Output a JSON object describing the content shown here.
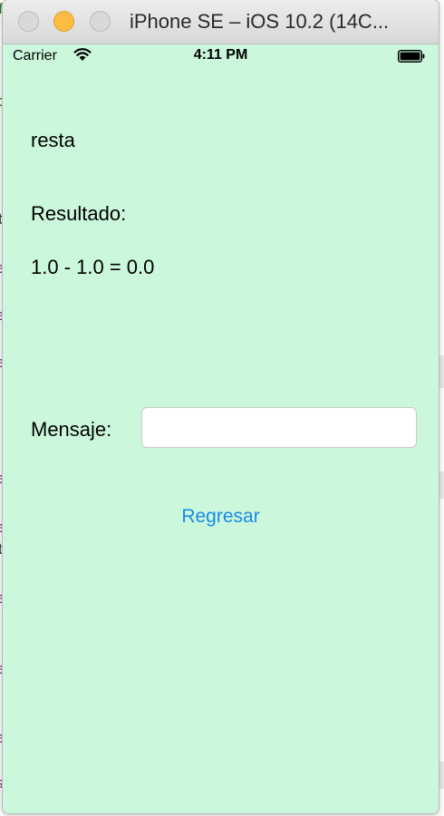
{
  "window": {
    "title": "iPhone SE – iOS 10.2 (14C..."
  },
  "status_bar": {
    "carrier": "Carrier",
    "time": "4:11 PM"
  },
  "screen": {
    "operation": "resta",
    "result_title": "Resultado:",
    "result_value": "1.0 - 1.0 = 0.0",
    "message_label": "Mensaje:",
    "message_value": "",
    "back_button_label": "Regresar"
  },
  "colors": {
    "screen_background": "#cbf8dc",
    "link_blue": "#1a8ae6",
    "minimize_yellow": "#fdbc40"
  }
}
